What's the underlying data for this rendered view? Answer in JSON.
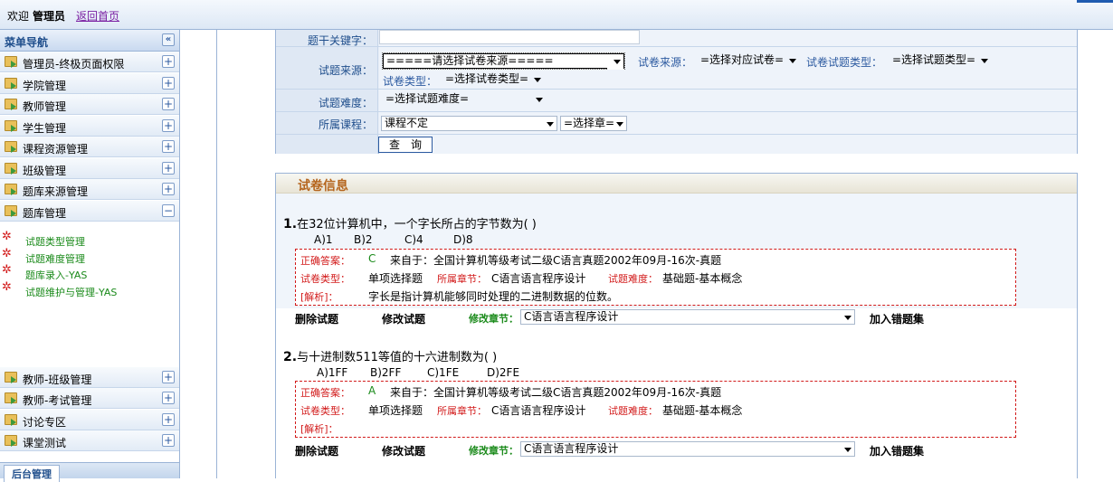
{
  "topbar": {
    "welcome": "欢迎",
    "user": "管理员",
    "home_link": "返回首页"
  },
  "sidebar": {
    "title": "菜单导航",
    "collapse_symbol": "«",
    "items": [
      {
        "label": "管理员-终极页面权限",
        "toggle": "+"
      },
      {
        "label": "学院管理",
        "toggle": "+"
      },
      {
        "label": "教师管理",
        "toggle": "+"
      },
      {
        "label": "学生管理",
        "toggle": "+"
      },
      {
        "label": "课程资源管理",
        "toggle": "+"
      },
      {
        "label": "班级管理",
        "toggle": "+"
      },
      {
        "label": "题库来源管理",
        "toggle": "+"
      },
      {
        "label": "题库管理",
        "toggle": "−"
      }
    ],
    "sub_items": [
      {
        "label": "试题类型管理"
      },
      {
        "label": "试题难度管理"
      },
      {
        "label": "题库录入-YAS"
      },
      {
        "label": "试题维护与管理-YAS"
      }
    ],
    "bottom_items": [
      {
        "label": "教师-班级管理",
        "toggle": "+"
      },
      {
        "label": "教师-考试管理",
        "toggle": "+"
      },
      {
        "label": "讨论专区",
        "toggle": "+"
      },
      {
        "label": "课堂测试",
        "toggle": "+"
      }
    ],
    "bottom_tab": "后台管理"
  },
  "search": {
    "keyword_label": "题干关键字：",
    "keyword_value": "",
    "source_label": "试题来源：",
    "source_select": "=====请选择试卷来源=====",
    "paper_source_label": "试卷来源：",
    "paper_source_select": "=选择对应试卷=",
    "question_type_label": "试卷试题类型：",
    "question_type_select": "=选择试题类型=",
    "paper_type_label": "试卷类型：",
    "paper_type_select": "=选择试卷类型=",
    "difficulty_label": "试题难度：",
    "difficulty_select": "=选择试题难度=",
    "course_label": "所属课程：",
    "course_select": "课程不定",
    "chapter_select": "=选择章=",
    "query_button": "查　询"
  },
  "paper": {
    "header": "试卷信息",
    "questions": [
      {
        "num": "1.",
        "text": "在32位计算机中，一个字长所占的字节数为(  )",
        "options": [
          "A)1",
          "B)2",
          "C)4",
          "D)8"
        ],
        "answer_label": "正确答案：",
        "answer": "C",
        "source": "来自于：全国计算机等级考试二级C语言真题2002年09月-16次-真题",
        "type_label": "试卷类型：",
        "type": "单项选择题",
        "chapter_label": "所属章节：",
        "chapter": "C语言语言程序设计",
        "difficulty_label": "试题难度：",
        "difficulty": "基础题-基本概念",
        "analysis_label": "[解析]：",
        "analysis": "字长是指计算机能够同时处理的二进制数据的位数。",
        "delete": "删除试题",
        "edit": "修改试题",
        "change_chapter_label": "修改章节：",
        "change_chapter_value": "C语言语言程序设计",
        "add_wrong": "加入错题集"
      },
      {
        "num": "2.",
        "text": "与十进制数511等值的十六进制数为(  )",
        "options": [
          "A)1FF",
          "B)2FF",
          "C)1FE",
          "D)2FE"
        ],
        "answer_label": "正确答案：",
        "answer": "A",
        "source": "来自于：全国计算机等级考试二级C语言真题2002年09月-16次-真题",
        "type_label": "试卷类型：",
        "type": "单项选择题",
        "chapter_label": "所属章节：",
        "chapter": "C语言语言程序设计",
        "difficulty_label": "试题难度：",
        "difficulty": "基础题-基本概念",
        "analysis_label": "[解析]：",
        "analysis": "",
        "delete": "删除试题",
        "edit": "修改试题",
        "change_chapter_label": "修改章节：",
        "change_chapter_value": "C语言语言程序设计",
        "add_wrong": "加入错题集"
      }
    ]
  },
  "colors": {
    "accent_blue": "#2c5aa0",
    "label_red": "#d21a1a",
    "label_green": "#1a8a1a",
    "header_orange": "#b5651d"
  }
}
